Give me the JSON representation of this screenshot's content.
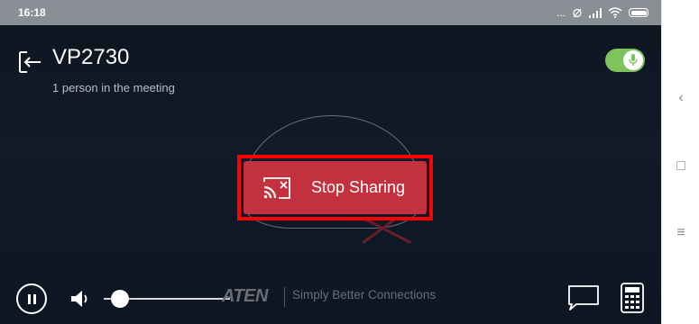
{
  "status_bar": {
    "time": "16:18",
    "indicator_dots": "...",
    "icons": [
      "alarm-icon",
      "signal-icon",
      "wifi-icon",
      "battery-icon"
    ]
  },
  "header": {
    "room_name": "VP2730",
    "participants": "1 person in the meeting"
  },
  "mic_toggle": {
    "state": "on",
    "color": "#7cc45b"
  },
  "stop_button": {
    "label": "Stop Sharing",
    "color": "#c3303e",
    "highlight_color": "#ff0000"
  },
  "controls": {
    "volume_level": 0.06,
    "brand": "ATEN",
    "tagline": "Simply Better Connections"
  },
  "nav_bar": {
    "back_glyph": "‹",
    "home_glyph": "□",
    "menu_glyph": "≡"
  }
}
